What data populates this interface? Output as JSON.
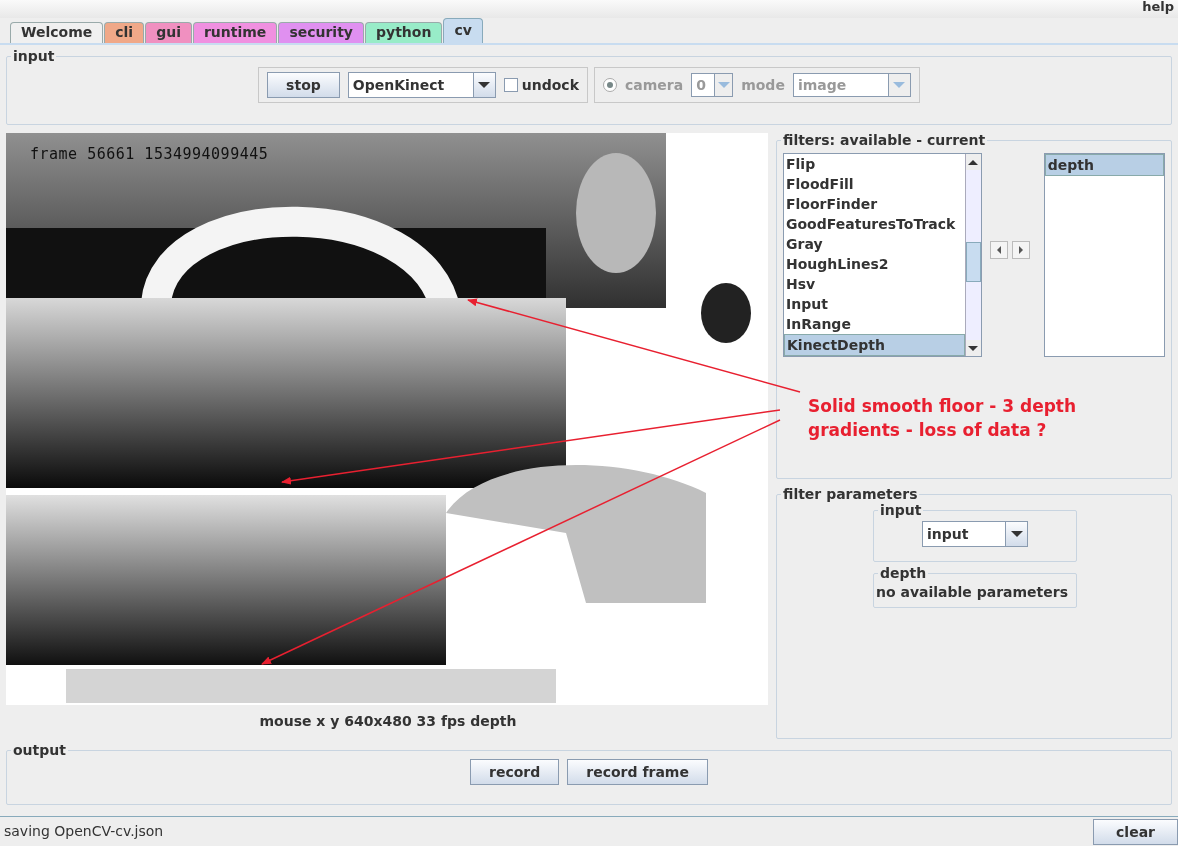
{
  "menu": {
    "help": "help"
  },
  "tabs": [
    {
      "label": "Welcome",
      "color": "#f0f0f0",
      "selected": false
    },
    {
      "label": "cli",
      "color": "#f0a888",
      "selected": false
    },
    {
      "label": "gui",
      "color": "#f090c0",
      "selected": false
    },
    {
      "label": "runtime",
      "color": "#f090e0",
      "selected": false
    },
    {
      "label": "security",
      "color": "#e090f0",
      "selected": false
    },
    {
      "label": "python",
      "color": "#98ecc8",
      "selected": false
    },
    {
      "label": "cv",
      "color": "#c8dcf0",
      "selected": true
    }
  ],
  "input_panel": {
    "title": "input",
    "stop_button": "stop",
    "source": "OpenKinect",
    "undock": {
      "label": "undock",
      "checked": false
    },
    "camera": {
      "selected": true,
      "disabled": true,
      "label": "camera",
      "index": "0",
      "mode_label": "mode",
      "mode": "image"
    }
  },
  "video": {
    "overlay_text": "frame 56661 1534994099445",
    "caption": "mouse x y 640x480 33 fps depth"
  },
  "filters": {
    "title": "filters: available - current",
    "available": [
      {
        "label": "Flip",
        "selected": false
      },
      {
        "label": "FloodFill",
        "selected": false
      },
      {
        "label": "FloorFinder",
        "selected": false
      },
      {
        "label": "GoodFeaturesToTrack",
        "selected": false
      },
      {
        "label": "Gray",
        "selected": false
      },
      {
        "label": "HoughLines2",
        "selected": false
      },
      {
        "label": "Hsv",
        "selected": false
      },
      {
        "label": "Input",
        "selected": false
      },
      {
        "label": "InRange",
        "selected": false
      },
      {
        "label": "KinectDepth",
        "selected": true
      }
    ],
    "current": [
      {
        "label": "depth",
        "selected": true
      }
    ]
  },
  "filter_parameters": {
    "title": "filter parameters",
    "groups": [
      {
        "kind": "select",
        "title": "input",
        "value": "input"
      },
      {
        "kind": "text",
        "title": "depth",
        "text": "no available parameters"
      }
    ]
  },
  "output": {
    "title": "output",
    "buttons": [
      "record",
      "record frame"
    ]
  },
  "status_bar": {
    "message": "saving OpenCV-cv.json",
    "clear_button": "clear"
  },
  "annotation": {
    "text": "Solid smooth floor - 3 depth gradients - loss of data ?"
  }
}
